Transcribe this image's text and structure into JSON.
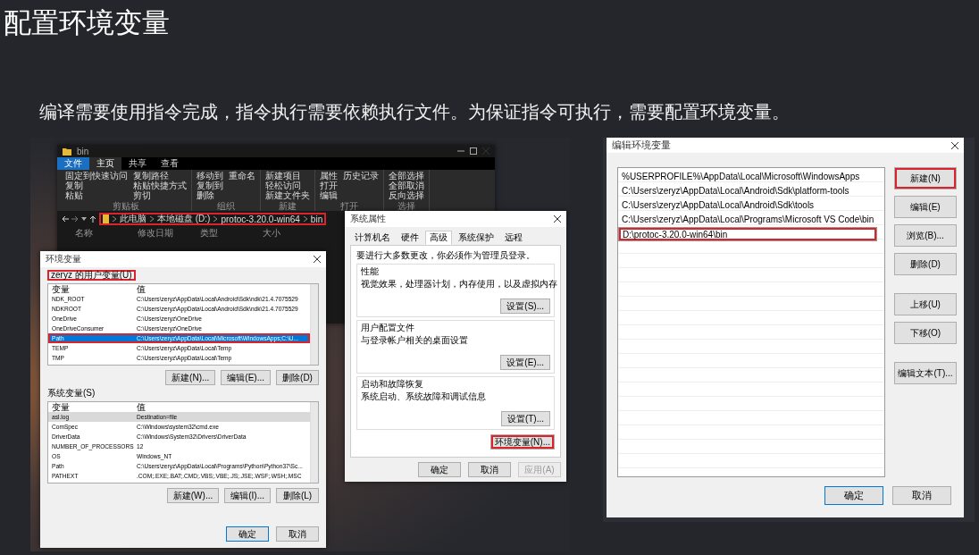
{
  "slide": {
    "title": "配置环境变量",
    "subtitle": "编译需要使用指令完成，指令执行需要依赖执行文件。为保证指令可执行，需要配置环境变量。"
  },
  "explorer": {
    "title": "bin",
    "tabs": [
      {
        "label": "文件",
        "selected": false,
        "kind": "file"
      },
      {
        "label": "主页",
        "selected": true,
        "kind": "tab"
      },
      {
        "label": "共享",
        "selected": false,
        "kind": "tab"
      },
      {
        "label": "查看",
        "selected": false,
        "kind": "tab"
      }
    ],
    "ribbon_groups": [
      {
        "label": "剪贴板",
        "commands": [
          "固定到快速访问",
          "复制",
          "粘贴",
          "复制路径",
          "粘贴快捷方式",
          "剪切"
        ]
      },
      {
        "label": "组织",
        "commands": [
          "移动到",
          "复制到",
          "删除",
          "重命名"
        ]
      },
      {
        "label": "新建",
        "commands": [
          "新建项目",
          "轻松访问",
          "新建文件夹"
        ]
      },
      {
        "label": "打开",
        "commands": [
          "属性",
          "打开",
          "编辑",
          "历史记录"
        ]
      },
      {
        "label": "选择",
        "commands": [
          "全部选择",
          "全部取消",
          "反向选择"
        ]
      }
    ],
    "address": {
      "segments": [
        "此电脑",
        "本地磁盘 (D:)",
        "protoc-3.20.0-win64",
        "bin"
      ],
      "highlighted": true
    },
    "columns": [
      "名称",
      "修改日期",
      "类型",
      "大小"
    ]
  },
  "env_dialog": {
    "title": "环境变量",
    "user_vars": {
      "label": "zeryz 的用户变量(U)",
      "highlighted": true,
      "focused": true,
      "columns": [
        "变量",
        "值"
      ],
      "rows": [
        {
          "name": "NDK_ROOT",
          "value": "C:\\Users\\zeryz\\AppData\\Local\\Android\\Sdk\\ndk\\21.4.7075529",
          "selected": false,
          "highlighted": false
        },
        {
          "name": "NDKROOT",
          "value": "C:\\Users\\zeryz\\AppData\\Local\\Android\\Sdk\\ndk\\21.4.7075529",
          "selected": false,
          "highlighted": false
        },
        {
          "name": "OneDrive",
          "value": "C:\\Users\\zeryz\\OneDrive",
          "selected": false,
          "highlighted": false
        },
        {
          "name": "OneDriveConsumer",
          "value": "C:\\Users\\zeryz\\OneDrive",
          "selected": false,
          "highlighted": false
        },
        {
          "name": "Path",
          "value": "C:\\Users\\zeryz\\AppData\\Local\\Microsoft\\WindowsApps;C:\\U...",
          "selected": true,
          "highlighted": true
        },
        {
          "name": "TEMP",
          "value": "C:\\Users\\zeryz\\AppData\\Local\\Temp",
          "selected": false,
          "highlighted": false
        },
        {
          "name": "TMP",
          "value": "C:\\Users\\zeryz\\AppData\\Local\\Temp",
          "selected": false,
          "highlighted": false
        }
      ],
      "buttons": [
        "新建(N)...",
        "编辑(E)...",
        "删除(D)"
      ]
    },
    "system_vars": {
      "label": "系统变量(S)",
      "highlighted": false,
      "focused": false,
      "columns": [
        "变量",
        "值"
      ],
      "rows": [
        {
          "name": "asl.log",
          "value": "Destination=file",
          "selected": true,
          "highlighted": false
        },
        {
          "name": "ComSpec",
          "value": "C:\\Windows\\system32\\cmd.exe",
          "selected": false,
          "highlighted": false
        },
        {
          "name": "DriverData",
          "value": "C:\\Windows\\System32\\Drivers\\DriverData",
          "selected": false,
          "highlighted": false
        },
        {
          "name": "NUMBER_OF_PROCESSORS",
          "value": "12",
          "selected": false,
          "highlighted": false
        },
        {
          "name": "OS",
          "value": "Windows_NT",
          "selected": false,
          "highlighted": false
        },
        {
          "name": "Path",
          "value": "C:\\Users\\zeryz\\AppData\\Local\\Programs\\Python\\Python37\\Sc...",
          "selected": false,
          "highlighted": false
        },
        {
          "name": "PATHEXT",
          "value": ".COM;.EXE;.BAT;.CMD;.VBS;.VBE;.JS;.JSE;.WSF;.WSH;.MSC",
          "selected": false,
          "highlighted": false
        }
      ],
      "buttons": [
        "新建(W)...",
        "编辑(I)...",
        "删除(L)"
      ]
    },
    "buttons": [
      {
        "label": "确定",
        "default": true
      },
      {
        "label": "取消",
        "default": false
      }
    ]
  },
  "system_properties": {
    "title": "系统属性",
    "tabs": [
      {
        "label": "计算机名",
        "selected": false
      },
      {
        "label": "硬件",
        "selected": false
      },
      {
        "label": "高级",
        "selected": true
      },
      {
        "label": "系统保护",
        "selected": false
      },
      {
        "label": "远程",
        "selected": false
      }
    ],
    "note": "要进行大多数更改，你必须作为管理员登录。",
    "groups": [
      {
        "label": "性能",
        "description": "视觉效果，处理器计划，内存使用，以及虚拟内存",
        "button": "设置(S)..."
      },
      {
        "label": "用户配置文件",
        "description": "与登录帐户相关的桌面设置",
        "button": "设置(E)..."
      },
      {
        "label": "启动和故障恢复",
        "description": "系统启动、系统故障和调试信息",
        "button": "设置(T)..."
      }
    ],
    "env_button": {
      "label": "环境变量(N)...",
      "highlighted": true
    },
    "buttons": [
      {
        "label": "确定",
        "disabled": false
      },
      {
        "label": "取消",
        "disabled": false
      },
      {
        "label": "应用(A)",
        "disabled": true
      }
    ]
  },
  "edit_dialog": {
    "title": "编辑环境变量",
    "items": [
      {
        "text": "%USERPROFILE%\\AppData\\Local\\Microsoft\\WindowsApps",
        "highlighted": false,
        "editing": false
      },
      {
        "text": "C:\\Users\\zeryz\\AppData\\Local\\Android\\Sdk\\platform-tools",
        "highlighted": false,
        "editing": false
      },
      {
        "text": "C:\\Users\\zeryz\\AppData\\Local\\Android\\Sdk\\tools",
        "highlighted": false,
        "editing": false
      },
      {
        "text": "C:\\Users\\zeryz\\AppData\\Local\\Programs\\Microsoft VS Code\\bin",
        "highlighted": false,
        "editing": false
      },
      {
        "text": "D:\\protoc-3.20.0-win64\\bin",
        "highlighted": true,
        "editing": true
      }
    ],
    "button_groups": [
      [
        {
          "label": "新建(N)",
          "highlighted": true
        },
        {
          "label": "编辑(E)",
          "highlighted": false
        },
        {
          "label": "浏览(B)...",
          "highlighted": false
        },
        {
          "label": "删除(D)",
          "highlighted": false
        }
      ],
      [
        {
          "label": "上移(U)",
          "highlighted": false
        },
        {
          "label": "下移(O)",
          "highlighted": false
        }
      ],
      [
        {
          "label": "编辑文本(T)...",
          "highlighted": false
        }
      ]
    ],
    "footer_buttons": [
      {
        "label": "确定",
        "default": true
      },
      {
        "label": "取消",
        "default": false
      }
    ]
  }
}
